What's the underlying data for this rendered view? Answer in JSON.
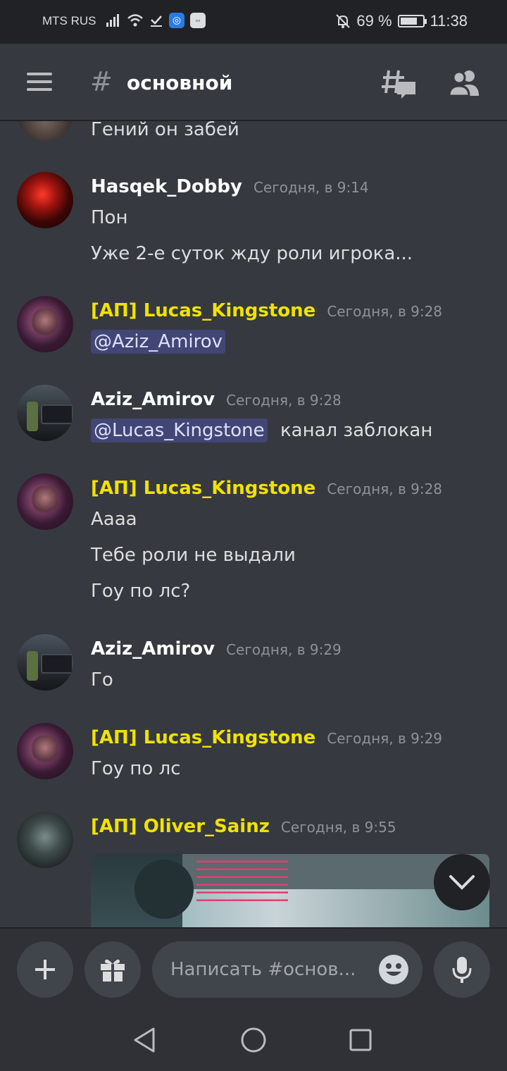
{
  "status_bar": {
    "carrier": "MTS RUS",
    "battery_percent": "69 %",
    "battery_level": 0.69,
    "time": "11:38"
  },
  "header": {
    "hash_symbol": "#",
    "channel_name": "основной",
    "icons": [
      "menu-icon",
      "threads-icon",
      "members-icon"
    ]
  },
  "messages": [
    {
      "text_lines": [
        "Гений он забей"
      ]
    },
    {
      "author": "Hasqek_Dobby",
      "timestamp": "Сегодня, в 9:14",
      "text_lines": [
        "Пон",
        "Уже 2-е суток жду роли игрока..."
      ]
    },
    {
      "author": "[АП] Lucas_Kingstone",
      "timestamp": "Сегодня, в 9:28",
      "mention": "@Aziz_Amirov"
    },
    {
      "author": "Aziz_Amirov",
      "timestamp": "Сегодня, в 9:28",
      "mention": "@Lucas_Kingstone",
      "text_after_mention": "канал заблокан"
    },
    {
      "author": "[АП] Lucas_Kingstone",
      "timestamp": "Сегодня, в 9:28",
      "text_lines": [
        "Аааа",
        "Тебе роли не выдали",
        "Гоу по лс?"
      ]
    },
    {
      "author": "Aziz_Amirov",
      "timestamp": "Сегодня, в 9:29",
      "text_lines": [
        "Го"
      ]
    },
    {
      "author": "[АП] Lucas_Kingstone",
      "timestamp": "Сегодня, в 9:29",
      "text_lines": [
        "Гоу по лс"
      ]
    },
    {
      "author": "[АП] Oliver_Sainz",
      "timestamp": "Сегодня, в 9:55",
      "attachment": "image"
    }
  ],
  "composer": {
    "placeholder": "Написать #основ..."
  },
  "colors": {
    "background": "#36393f",
    "admin_name": "#f1e200",
    "mention_bg": "#414675"
  }
}
